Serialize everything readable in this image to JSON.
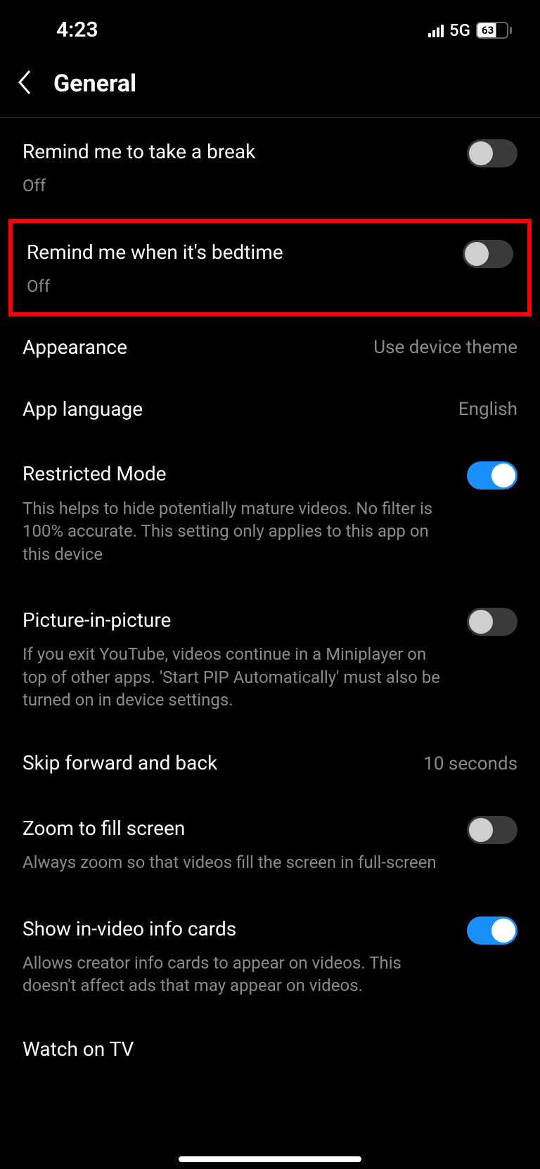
{
  "status_bar": {
    "time": "4:23",
    "network_type": "5G",
    "battery_level": "63"
  },
  "header": {
    "title": "General"
  },
  "settings": {
    "break": {
      "title": "Remind me to take a break",
      "sub": "Off"
    },
    "bedtime": {
      "title": "Remind me when it's bedtime",
      "sub": "Off"
    },
    "appearance": {
      "title": "Appearance",
      "value": "Use device theme"
    },
    "language": {
      "title": "App language",
      "value": "English"
    },
    "restricted": {
      "title": "Restricted Mode",
      "sub": "This helps to hide potentially mature videos. No filter is 100% accurate. This setting only applies to this app on this device"
    },
    "pip": {
      "title": "Picture-in-picture",
      "sub": "If you exit YouTube, videos continue in a Miniplayer on top of other apps. 'Start PIP Automatically' must also be turned on in device settings."
    },
    "skip": {
      "title": "Skip forward and back",
      "value": "10 seconds"
    },
    "zoom": {
      "title": "Zoom to fill screen",
      "sub": "Always zoom so that videos fill the screen in full-screen"
    },
    "infocards": {
      "title": "Show in-video info cards",
      "sub": "Allows creator info cards to appear on videos. This doesn't affect ads that may appear on videos."
    },
    "watch_tv": {
      "title": "Watch on TV"
    }
  }
}
